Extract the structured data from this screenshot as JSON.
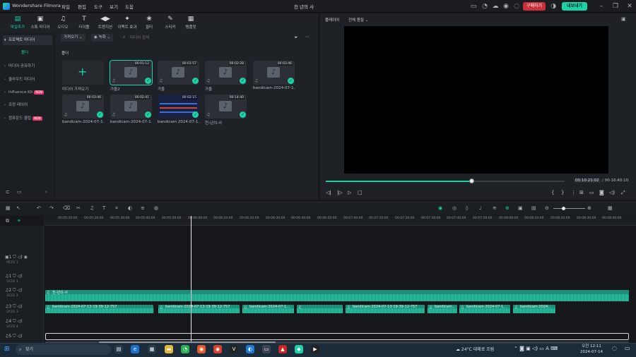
{
  "titlebar": {
    "app_name": "Wondershare Filmora",
    "menus": [
      "파일",
      "편집",
      "도구",
      "보기",
      "도움"
    ],
    "project_title": "천 년의 사",
    "buy_label": "구매하기",
    "export_label": "내보내기"
  },
  "toolbar": {
    "tools": [
      {
        "label": "파일추가",
        "icon": "folder-icon"
      },
      {
        "label": "스톡 미디어",
        "icon": "stock-icon"
      },
      {
        "label": "오디오",
        "icon": "music-icon"
      },
      {
        "label": "타이틀",
        "icon": "title-icon"
      },
      {
        "label": "트랜지션",
        "icon": "transition-icon"
      },
      {
        "label": "이펙트 효과",
        "icon": "effects-icon"
      },
      {
        "label": "필터",
        "icon": "filter-icon"
      },
      {
        "label": "스티커",
        "icon": "sticker-icon"
      },
      {
        "label": "템플릿",
        "icon": "template-icon"
      }
    ]
  },
  "sidebar": {
    "items": [
      {
        "label": "프로젝트 미디어",
        "type": "head"
      },
      {
        "label": "폴더",
        "type": "sub"
      },
      {
        "label": "미디어 공유하기",
        "type": "item"
      },
      {
        "label": "클라우드 미디어",
        "type": "item"
      },
      {
        "label": "Influence Kit",
        "type": "item",
        "badge": "NEW"
      },
      {
        "label": "조정 레이어",
        "type": "item"
      },
      {
        "label": "컴퓨운드 클립",
        "type": "item",
        "badge": "NEW"
      }
    ]
  },
  "filter_bar": {
    "import_dd": "가져오기",
    "record_dd": "녹화",
    "search_placeholder": "미디어 검색"
  },
  "media": {
    "folder_label": "폴더",
    "import_label": "미디어 가져오기",
    "items": [
      {
        "name": "가을2",
        "duration": "00:01:12",
        "kind": "audio",
        "selected": true
      },
      {
        "name": "가을",
        "duration": "00:01:57",
        "kind": "audio"
      },
      {
        "name": "가을",
        "duration": "00:02:28",
        "kind": "audio"
      },
      {
        "name": "bandicam-2024-07-1...",
        "duration": "00:03:46",
        "kind": "audio"
      },
      {
        "name": "bandicam-2024-07-1...",
        "duration": "00:03:46",
        "kind": "audio"
      },
      {
        "name": "bandicam-2024-07-1...",
        "duration": "00:02:41",
        "kind": "audio"
      },
      {
        "name": "bandicam 2024-07-1...",
        "duration": "00:02:15",
        "kind": "video"
      },
      {
        "name": "천-년의-사",
        "duration": "00:14:40",
        "kind": "audio"
      }
    ]
  },
  "preview": {
    "player_label": "플레이어",
    "quality": "전체 품질",
    "time_current": "00:10:21:02",
    "time_total": "/ 00:16:40:10",
    "progress": 0.61
  },
  "timeline": {
    "ticks": [
      "00:05:10:00",
      "00:05:20:00",
      "00:05:30:00",
      "00:05:40:00",
      "00:05:50:00",
      "00:06:00:00",
      "00:06:10:00",
      "00:06:20:00",
      "00:06:30:00",
      "00:06:40:00",
      "00:06:50:00",
      "00:07:00:00",
      "00:07:10:00",
      "00:07:20:00",
      "00:07:30:00",
      "00:07:40:00",
      "00:07:50:00",
      "00:08:00:00",
      "00:08:10:00",
      "00:08:20:00",
      "00:08:30:00",
      "00:08:40:00"
    ],
    "tracks": [
      {
        "num": "1",
        "name": "비디오 1"
      },
      {
        "num": "1",
        "name": "오디오 1"
      },
      {
        "num": "2",
        "name": "오디오 2"
      },
      {
        "num": "3",
        "name": "오디오 3"
      },
      {
        "num": "4",
        "name": "오디오 4"
      },
      {
        "num": "5",
        "name": ""
      }
    ],
    "track2_clip": "천-년의-사",
    "track3_clips": [
      "bandicam-2024-07-13-19-39-12-757",
      "bandicam-2024-07-13-19-39-12-757",
      "bandicam-2024-07-1...",
      "bandicam-2024-07-13-19-39-12-757",
      "bandicam...",
      "bandicam-2024-07-1...",
      "bandicam-2024..."
    ]
  },
  "taskbar": {
    "search_label": "찾기",
    "weather": "24°C 대체로 흐림",
    "time": "오전 12:11",
    "date": "2024-07-14"
  }
}
